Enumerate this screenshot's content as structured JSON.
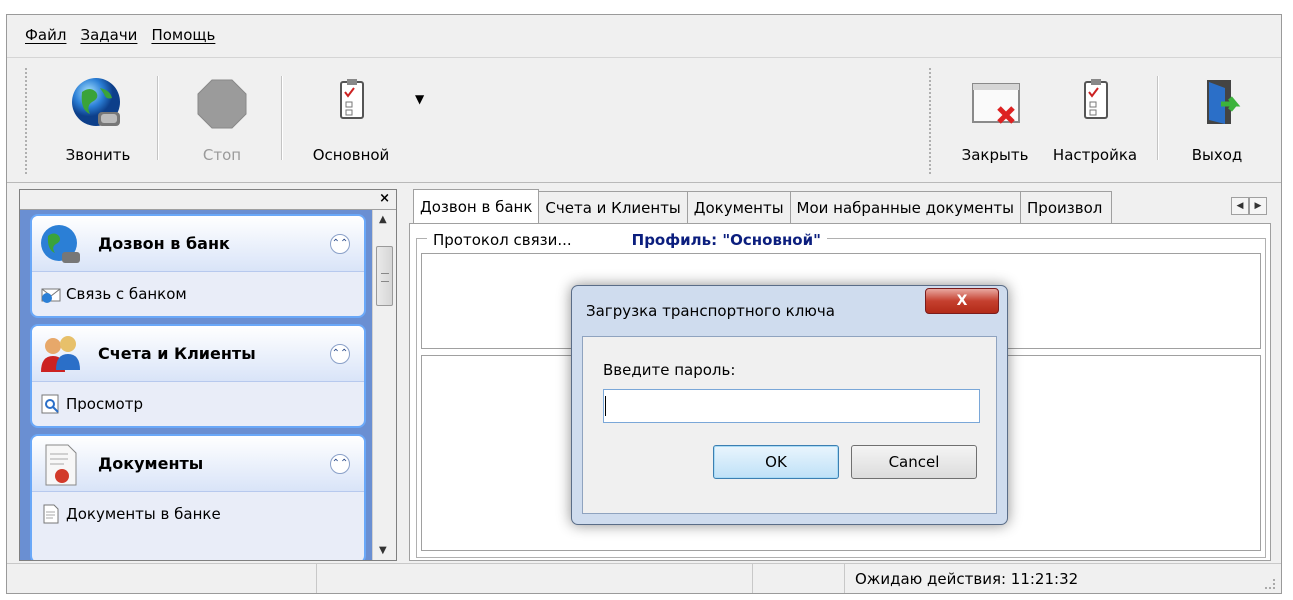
{
  "menu": {
    "items": [
      "Файл",
      "Задачи",
      "Помощь"
    ]
  },
  "toolbar": {
    "call_label": "Звонить",
    "stop_label": "Стоп",
    "profile_label": "Основной",
    "close_label": "Закрыть",
    "settings_label": "Настройка",
    "exit_label": "Выход"
  },
  "sidebar": {
    "groups": [
      {
        "title": "Дозвон в банк",
        "item": "Связь с банком"
      },
      {
        "title": "Счета и Клиенты",
        "item": "Просмотр"
      },
      {
        "title": "Документы",
        "item": "Документы в банке"
      }
    ]
  },
  "tabs": [
    "Дозвон в банк",
    "Счета и Клиенты",
    "Документы",
    "Мои набранные документы",
    "Произвол"
  ],
  "protocol": {
    "legend": "Протокол связи...",
    "profile": "Профиль: \"Основной\""
  },
  "dialog": {
    "title": "Загрузка транспортного ключа",
    "close": "X",
    "label": "Введите пароль:",
    "password_value": "",
    "ok": "OK",
    "cancel": "Cancel"
  },
  "status": {
    "text": "Ожидаю действия: 11:21:32"
  },
  "icons": {
    "call": "globe-phone-icon",
    "stop": "stop-octagon-icon",
    "profile": "clipboard-icon",
    "close": "close-window-icon",
    "settings": "clipboard-icon",
    "exit": "exit-door-icon"
  }
}
